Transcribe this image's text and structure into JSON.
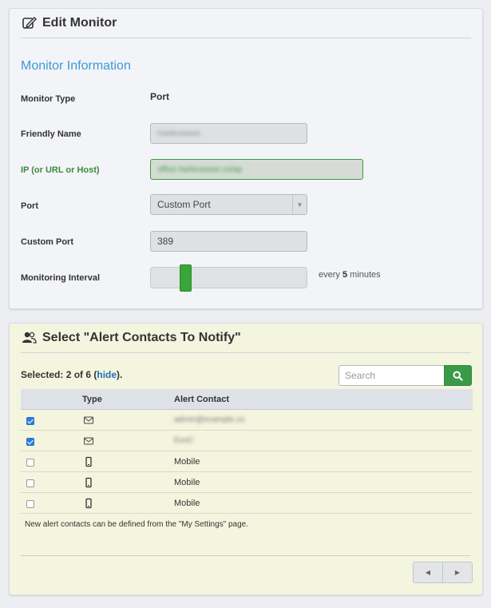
{
  "monitor_panel": {
    "title": "Edit Monitor",
    "section_title": "Monitor Information",
    "fields": {
      "monitor_type_label": "Monitor Type",
      "monitor_type_value": "Port",
      "friendly_name_label": "Friendly Name",
      "friendly_name_value": "Harbosease",
      "ip_label": "IP (or URL or Host)",
      "ip_value": "office.harbosease.co/ap",
      "port_label": "Port",
      "port_value": "Custom Port",
      "custom_port_label": "Custom Port",
      "custom_port_value": "389",
      "interval_label": "Monitoring Interval",
      "interval_prefix": "every",
      "interval_value": "5",
      "interval_unit": "minutes",
      "interval_slider_fraction": 0.2
    }
  },
  "alerts_panel": {
    "title": "Select \"Alert Contacts To Notify\"",
    "selected_prefix": "Selected: 2 of 6 (",
    "hide_link": "hide",
    "selected_suffix": ").",
    "search_placeholder": "Search",
    "columns": {
      "type": "Type",
      "contact": "Alert Contact"
    },
    "rows": [
      {
        "checked": true,
        "type_icon": "envelope-icon",
        "contact": "admin@example.co"
      },
      {
        "checked": true,
        "type_icon": "envelope-icon",
        "contact": "ExoC"
      },
      {
        "checked": false,
        "type_icon": "mobile-phone-icon",
        "contact": "Mobile"
      },
      {
        "checked": false,
        "type_icon": "mobile-phone-icon",
        "contact": "Mobile"
      },
      {
        "checked": false,
        "type_icon": "mobile-phone-icon",
        "contact": "Mobile"
      }
    ],
    "note": "New alert contacts can be defined from the \"My Settings\" page."
  },
  "colors": {
    "accent_blue": "#3a9ad9",
    "valid_green": "#3e9a3e",
    "search_button_green": "#3a9a49",
    "slider_green": "#3aa53a",
    "alerts_bg": "#f4f5df"
  }
}
